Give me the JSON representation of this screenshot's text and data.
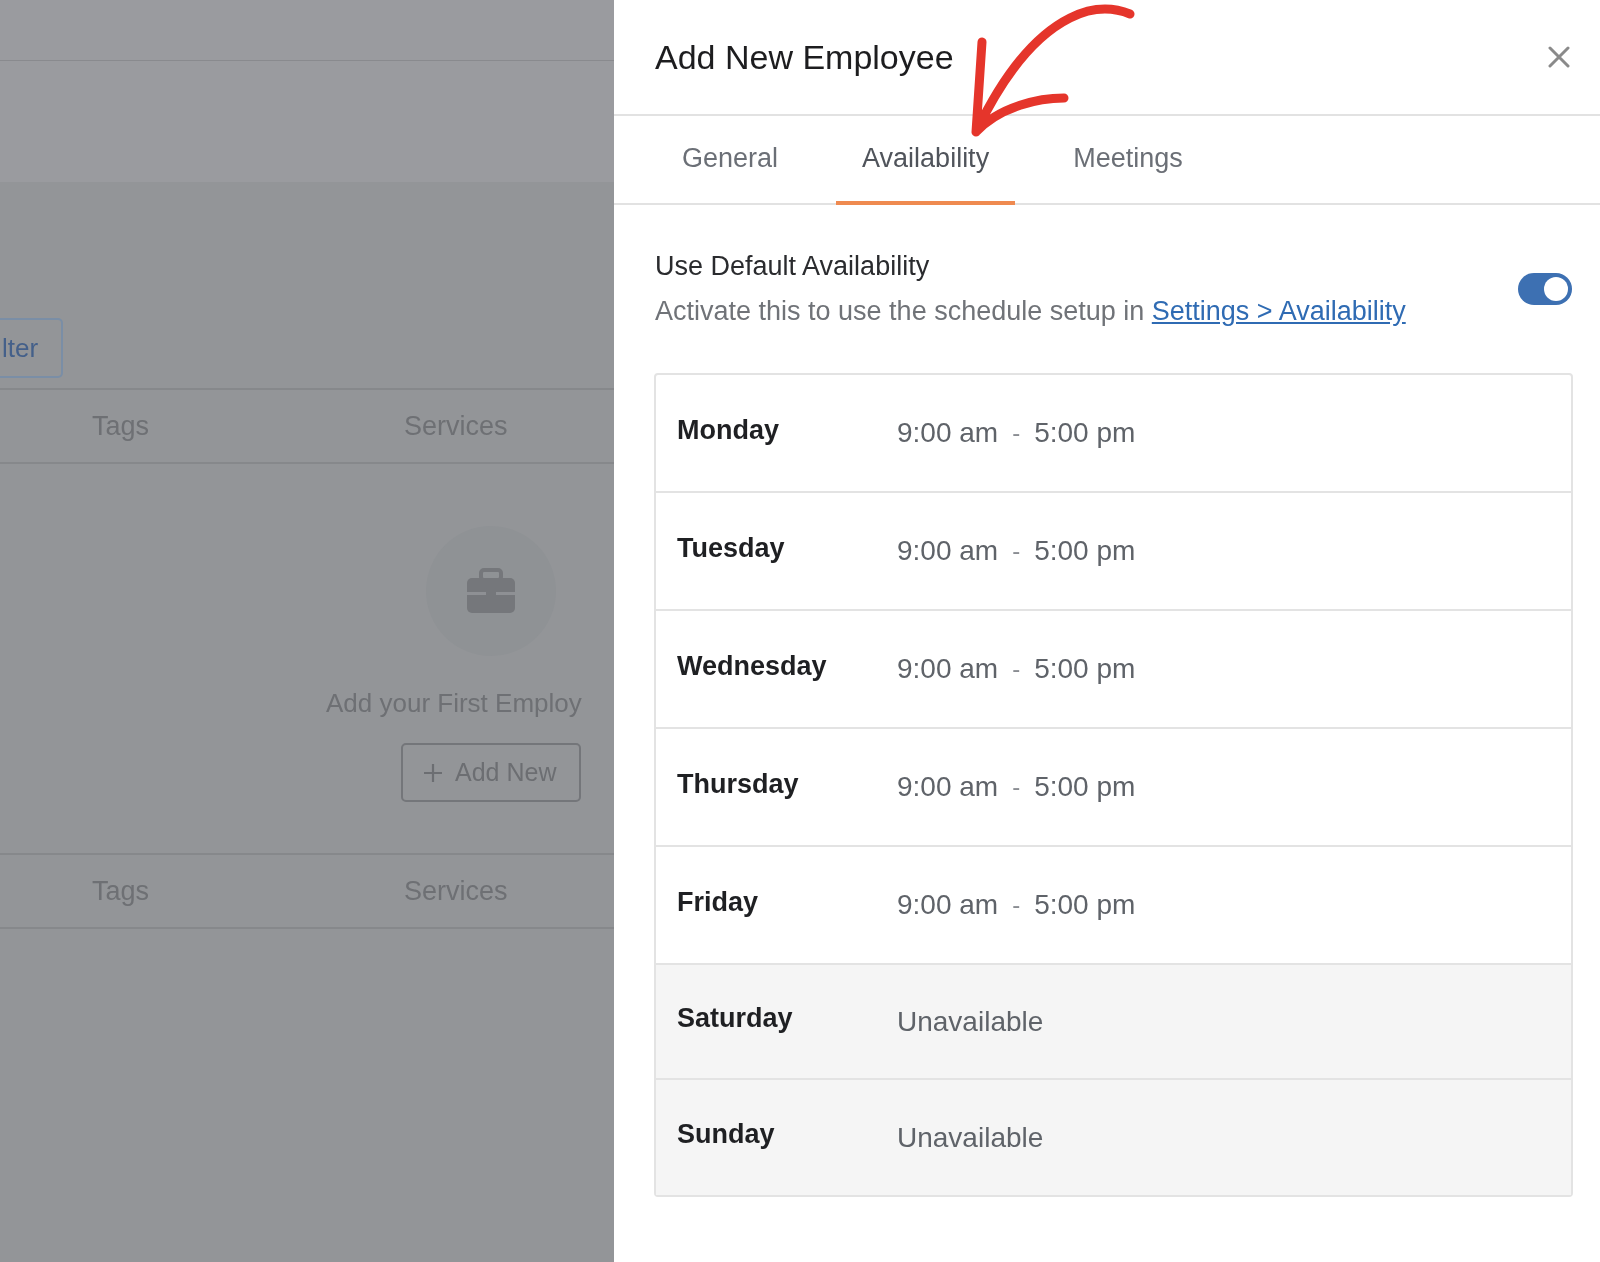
{
  "background_page": {
    "filter_button": "lter",
    "table_columns": [
      "Tags",
      "Services"
    ],
    "empty_state": {
      "message": "Add your First Employ",
      "button": "Add New"
    },
    "footer_columns": [
      "Tags",
      "Services"
    ]
  },
  "drawer": {
    "title": "Add New Employee",
    "tabs": [
      {
        "label": "General",
        "selected": false
      },
      {
        "label": "Availability",
        "selected": true
      },
      {
        "label": "Meetings",
        "selected": false
      }
    ],
    "default_availability": {
      "label": "Use Default Availability",
      "description": "Activate this to use the schedule setup in",
      "link": "Settings > Availability",
      "on": true
    },
    "schedule": [
      {
        "day": "Monday",
        "kind": "hours",
        "start": "9:00 am",
        "separator": "-",
        "end": "5:00 pm"
      },
      {
        "day": "Tuesday",
        "kind": "hours",
        "start": "9:00 am",
        "separator": "-",
        "end": "5:00 pm"
      },
      {
        "day": "Wednesday",
        "kind": "hours",
        "start": "9:00 am",
        "separator": "-",
        "end": "5:00 pm"
      },
      {
        "day": "Thursday",
        "kind": "hours",
        "start": "9:00 am",
        "separator": "-",
        "end": "5:00 pm"
      },
      {
        "day": "Friday",
        "kind": "hours",
        "start": "9:00 am",
        "separator": "-",
        "end": "5:00 pm"
      },
      {
        "day": "Saturday",
        "kind": "unavailable",
        "status": "Unavailable"
      },
      {
        "day": "Sunday",
        "kind": "unavailable",
        "status": "Unavailable"
      }
    ]
  }
}
